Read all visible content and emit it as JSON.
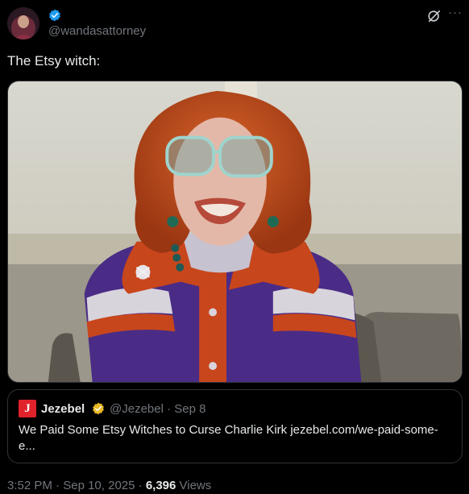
{
  "author": {
    "handle": "@wandasattorney",
    "verified": true
  },
  "tweet": {
    "text": "The Etsy witch:"
  },
  "quote": {
    "logo_letter": "J",
    "name": "Jezebel",
    "handle": "@Jezebel",
    "separator": "·",
    "date": "Sep 8",
    "text_line1": "We Paid Some Etsy Witches to Curse Charlie Kirk jezebel.com/we-paid-some-",
    "text_line2": "e..."
  },
  "footer": {
    "time": "3:52 PM",
    "dot1": " · ",
    "date": "Sep 10, 2025",
    "dot2": " · ",
    "views_count": "6,396",
    "views_label": " Views"
  },
  "colors": {
    "background": "#000000",
    "text": "#e7e9ea",
    "muted": "#71767b",
    "border": "#2f3336",
    "verified_blue": "#1d9bf0",
    "verified_gold": "#e8b829",
    "jezebel_red": "#e0222b"
  },
  "icons": [
    "verified-badge-icon",
    "grok-icon",
    "more-icon",
    "gold-verified-badge-icon"
  ]
}
